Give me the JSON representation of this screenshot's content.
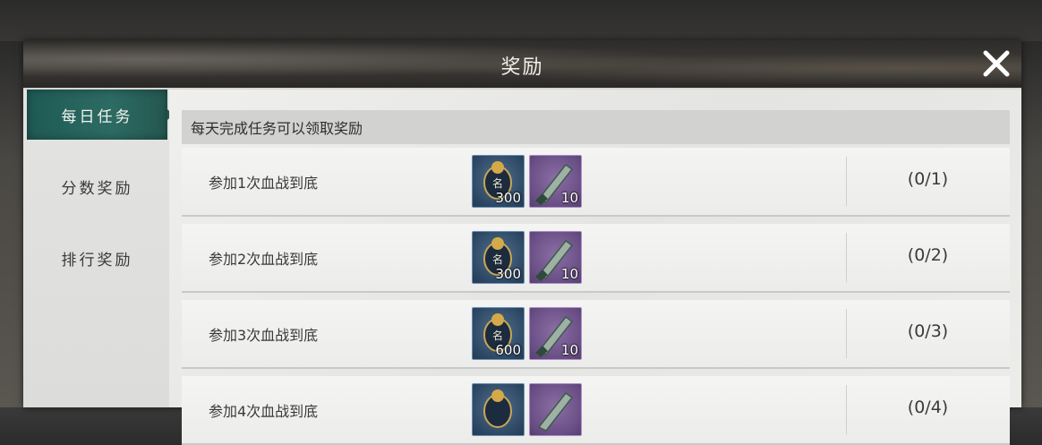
{
  "window": {
    "title": "奖励"
  },
  "tabs": [
    {
      "label": "每日任务",
      "active": true
    },
    {
      "label": "分数奖励",
      "active": false
    },
    {
      "label": "排行奖励",
      "active": false
    }
  ],
  "main": {
    "header": "每天完成任务可以领取奖励",
    "tasks": [
      {
        "label": "参加1次血战到底",
        "rewards": [
          {
            "icon": "fame-badge-icon",
            "quantity": "300"
          },
          {
            "icon": "jade-blade-icon",
            "quantity": "10"
          }
        ],
        "progress": "(0/1)"
      },
      {
        "label": "参加2次血战到底",
        "rewards": [
          {
            "icon": "fame-badge-icon",
            "quantity": "300"
          },
          {
            "icon": "jade-blade-icon",
            "quantity": "10"
          }
        ],
        "progress": "(0/2)"
      },
      {
        "label": "参加3次血战到底",
        "rewards": [
          {
            "icon": "fame-badge-icon",
            "quantity": "600"
          },
          {
            "icon": "jade-blade-icon",
            "quantity": "10"
          }
        ],
        "progress": "(0/3)"
      },
      {
        "label": "参加4次血战到底",
        "rewards": [
          {
            "icon": "fame-badge-icon",
            "quantity": ""
          },
          {
            "icon": "jade-blade-icon",
            "quantity": ""
          }
        ],
        "progress": "(0/4)"
      }
    ]
  },
  "colors": {
    "active_tab": "#2c6b63",
    "reward_blue": "#2f4a66",
    "reward_purple": "#6a4f86"
  }
}
